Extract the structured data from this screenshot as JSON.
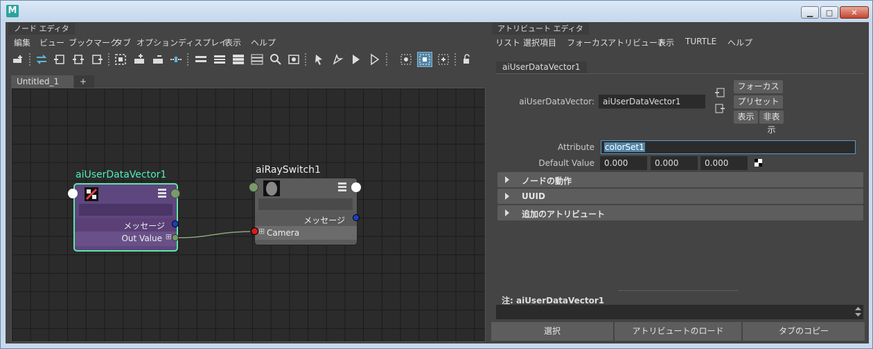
{
  "window": {
    "icon_letter": "M",
    "minimize": "▁",
    "maximize": "□",
    "close": "✕"
  },
  "node_editor": {
    "panel_title": "ノード エディタ",
    "menu": [
      "編集",
      "ビュー",
      "ブックマーク",
      "タブ",
      "オプション",
      "ディスプレイ",
      "表示",
      "ヘルプ"
    ],
    "tabs": [
      "Untitled_1",
      "+"
    ],
    "nodes": {
      "user_data": {
        "name": "aiUserDataVector1",
        "port_message": "メッセージ",
        "port_out": "Out Value",
        "plus": "⊞"
      },
      "ray_switch": {
        "name": "aiRaySwitch1",
        "port_message": "メッセージ",
        "port_camera": "Camera",
        "plus": "⊞"
      }
    }
  },
  "attribute_editor": {
    "panel_title": "アトリビュート エディタ",
    "menu": [
      "リスト",
      "選択項目",
      "フォーカス",
      "アトリビュート",
      "表示",
      "TURTLE",
      "ヘルプ"
    ],
    "tab": "aiUserDataVector1",
    "node_label": "aiUserDataVector:",
    "node_value": "aiUserDataVector1",
    "buttons": {
      "focus": "フォーカス",
      "presets": "プリセット",
      "show": "表示",
      "hide": "非表示"
    },
    "attribute_label": "Attribute",
    "attribute_value": "colorSet1",
    "default_label": "Default Value",
    "default_values": [
      "0.000",
      "0.000",
      "0.000"
    ],
    "sections": [
      "ノードの動作",
      "UUID",
      "追加のアトリビュート"
    ],
    "notes_label": "注:  aiUserDataVector1",
    "bottom_buttons": [
      "選択",
      "アトリビュートのロード",
      "タブのコピー"
    ]
  }
}
